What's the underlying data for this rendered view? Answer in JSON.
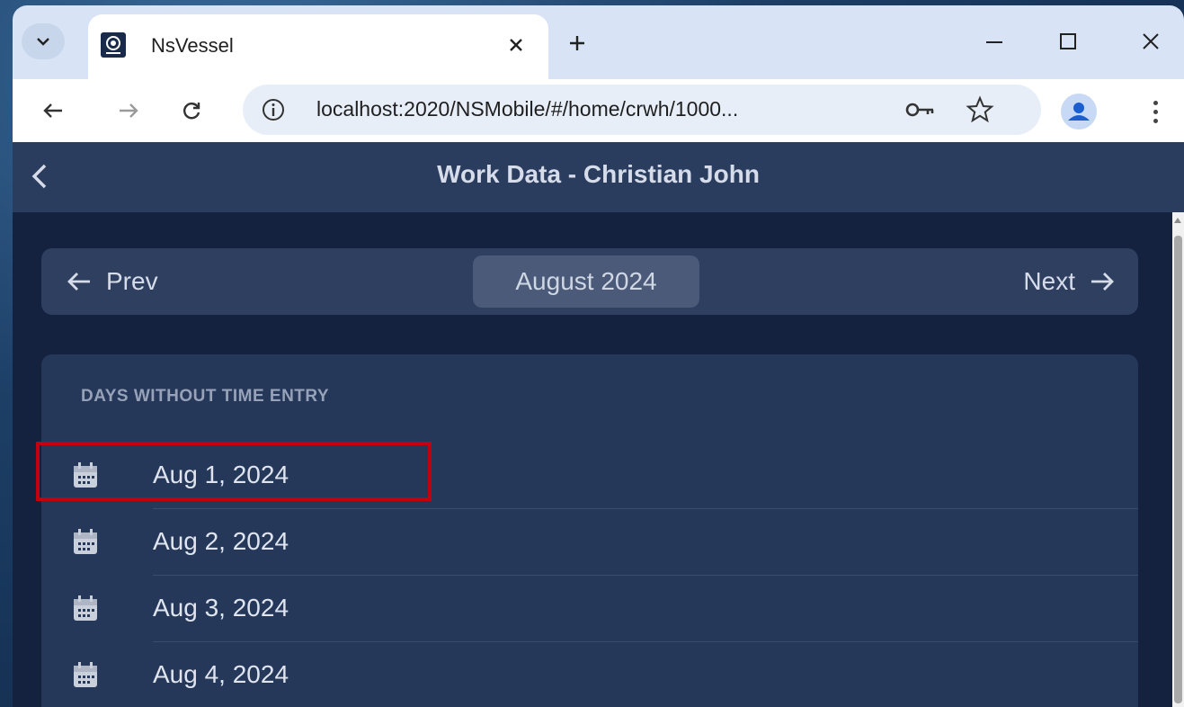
{
  "browser": {
    "tab_title": "NsVessel",
    "url": "localhost:2020/NSMobile/#/home/crwh/1000..."
  },
  "app": {
    "title": "Work Data - Christian John",
    "prev_label": "Prev",
    "next_label": "Next",
    "current_month": "August 2024",
    "section_label": "DAYS WITHOUT TIME ENTRY",
    "days": [
      {
        "label": "Aug 1, 2024"
      },
      {
        "label": "Aug 2, 2024"
      },
      {
        "label": "Aug 3, 2024"
      },
      {
        "label": "Aug 4, 2024"
      }
    ]
  },
  "colors": {
    "app_background": "#14223f",
    "app_bar": "#2b3d5e",
    "card": "#25385a",
    "highlight": "#c4000e"
  }
}
